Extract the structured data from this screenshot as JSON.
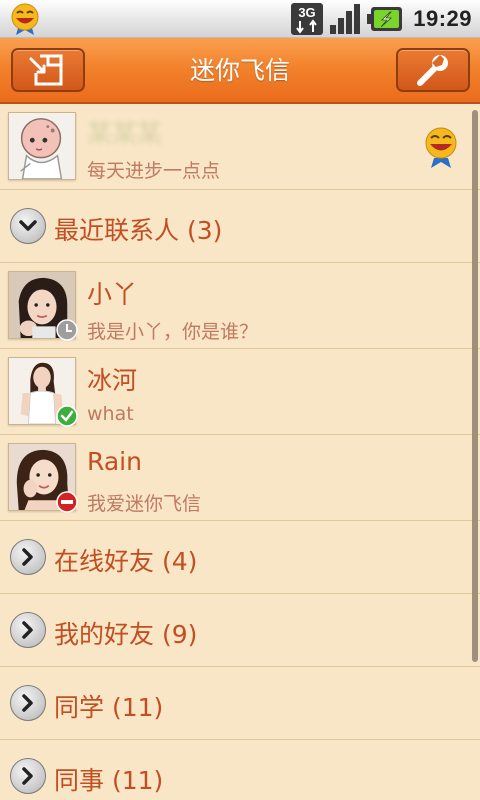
{
  "status_bar": {
    "network": "3G",
    "time": "19:29"
  },
  "title_bar": {
    "title": "迷你飞信",
    "left_icon": "compose-icon",
    "right_icon": "wrench-icon"
  },
  "profile": {
    "name": "某某某",
    "signature": "每天进步一点点",
    "status_icon": "fetion-smiley-icon"
  },
  "groups": [
    {
      "label": "最近联系人 (3)",
      "expanded": true,
      "contacts": [
        {
          "name": "小丫",
          "message": "我是小丫，你是谁？",
          "status": "away"
        },
        {
          "name": "冰河",
          "message": "what",
          "status": "online"
        },
        {
          "name": "Rain",
          "message": "我爱迷你飞信",
          "status": "busy"
        }
      ]
    },
    {
      "label": "在线好友 (4)",
      "expanded": false
    },
    {
      "label": "我的好友 (9)",
      "expanded": false
    },
    {
      "label": "同学 (11)",
      "expanded": false
    },
    {
      "label": "同事 (11)",
      "expanded": false
    }
  ],
  "colors": {
    "title_bar": "#f3822c",
    "background": "#f8e6c6",
    "name_text": "#c24f22",
    "sub_text": "#c07a62",
    "online": "#3dae3d",
    "busy": "#d22222",
    "away": "#9e9e9e"
  }
}
